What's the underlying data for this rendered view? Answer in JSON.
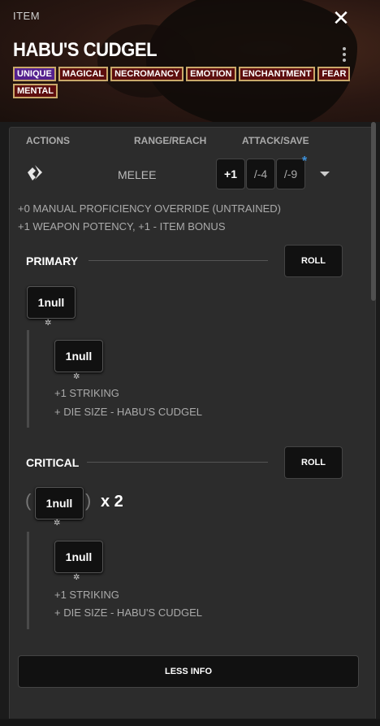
{
  "header": {
    "item_type": "ITEM",
    "title": "HABU'S CUDGEL",
    "traits": [
      "UNIQUE",
      "MAGICAL",
      "NECROMANCY",
      "EMOTION",
      "ENCHANTMENT",
      "FEAR",
      "MENTAL"
    ]
  },
  "columns": {
    "actions": "ACTIONS",
    "range": "RANGE/REACH",
    "attack": "ATTACK/SAVE"
  },
  "strike": {
    "action_icon": "one-action-icon",
    "range_value": "MELEE",
    "attacks": [
      "+1",
      "/-4",
      "/-9"
    ],
    "asterisk": "*"
  },
  "notes": {
    "proficiency": "+0 MANUAL PROFICIENCY OVERRIDE (UNTRAINED)",
    "potency": "+1 WEAPON POTENCY, +1 - ITEM BONUS"
  },
  "primary": {
    "label": "PRIMARY",
    "roll_label": "ROLL",
    "damage": "1null",
    "sub_damage": "1null",
    "mod1": "+1 STRIKING",
    "mod2": "+ DIE SIZE - HABU'S CUDGEL"
  },
  "critical": {
    "label": "CRITICAL",
    "roll_label": "ROLL",
    "damage": "1null",
    "multiplier": "x 2",
    "paren_open": "(",
    "paren_close": ")",
    "sub_damage": "1null",
    "mod1": "+1 STRIKING",
    "mod2": "+ DIE SIZE - HABU'S CUDGEL"
  },
  "footer": {
    "less_info": "LESS INFO"
  },
  "icons": {
    "close": "close-icon",
    "menu": "kebab-menu-icon",
    "gear": "gear-icon"
  },
  "colors": {
    "trait_bg": "#5d0e0e",
    "trait_border": "#c9a86a",
    "unique_bg": "#54208e",
    "asterisk": "#3b8fd9"
  }
}
